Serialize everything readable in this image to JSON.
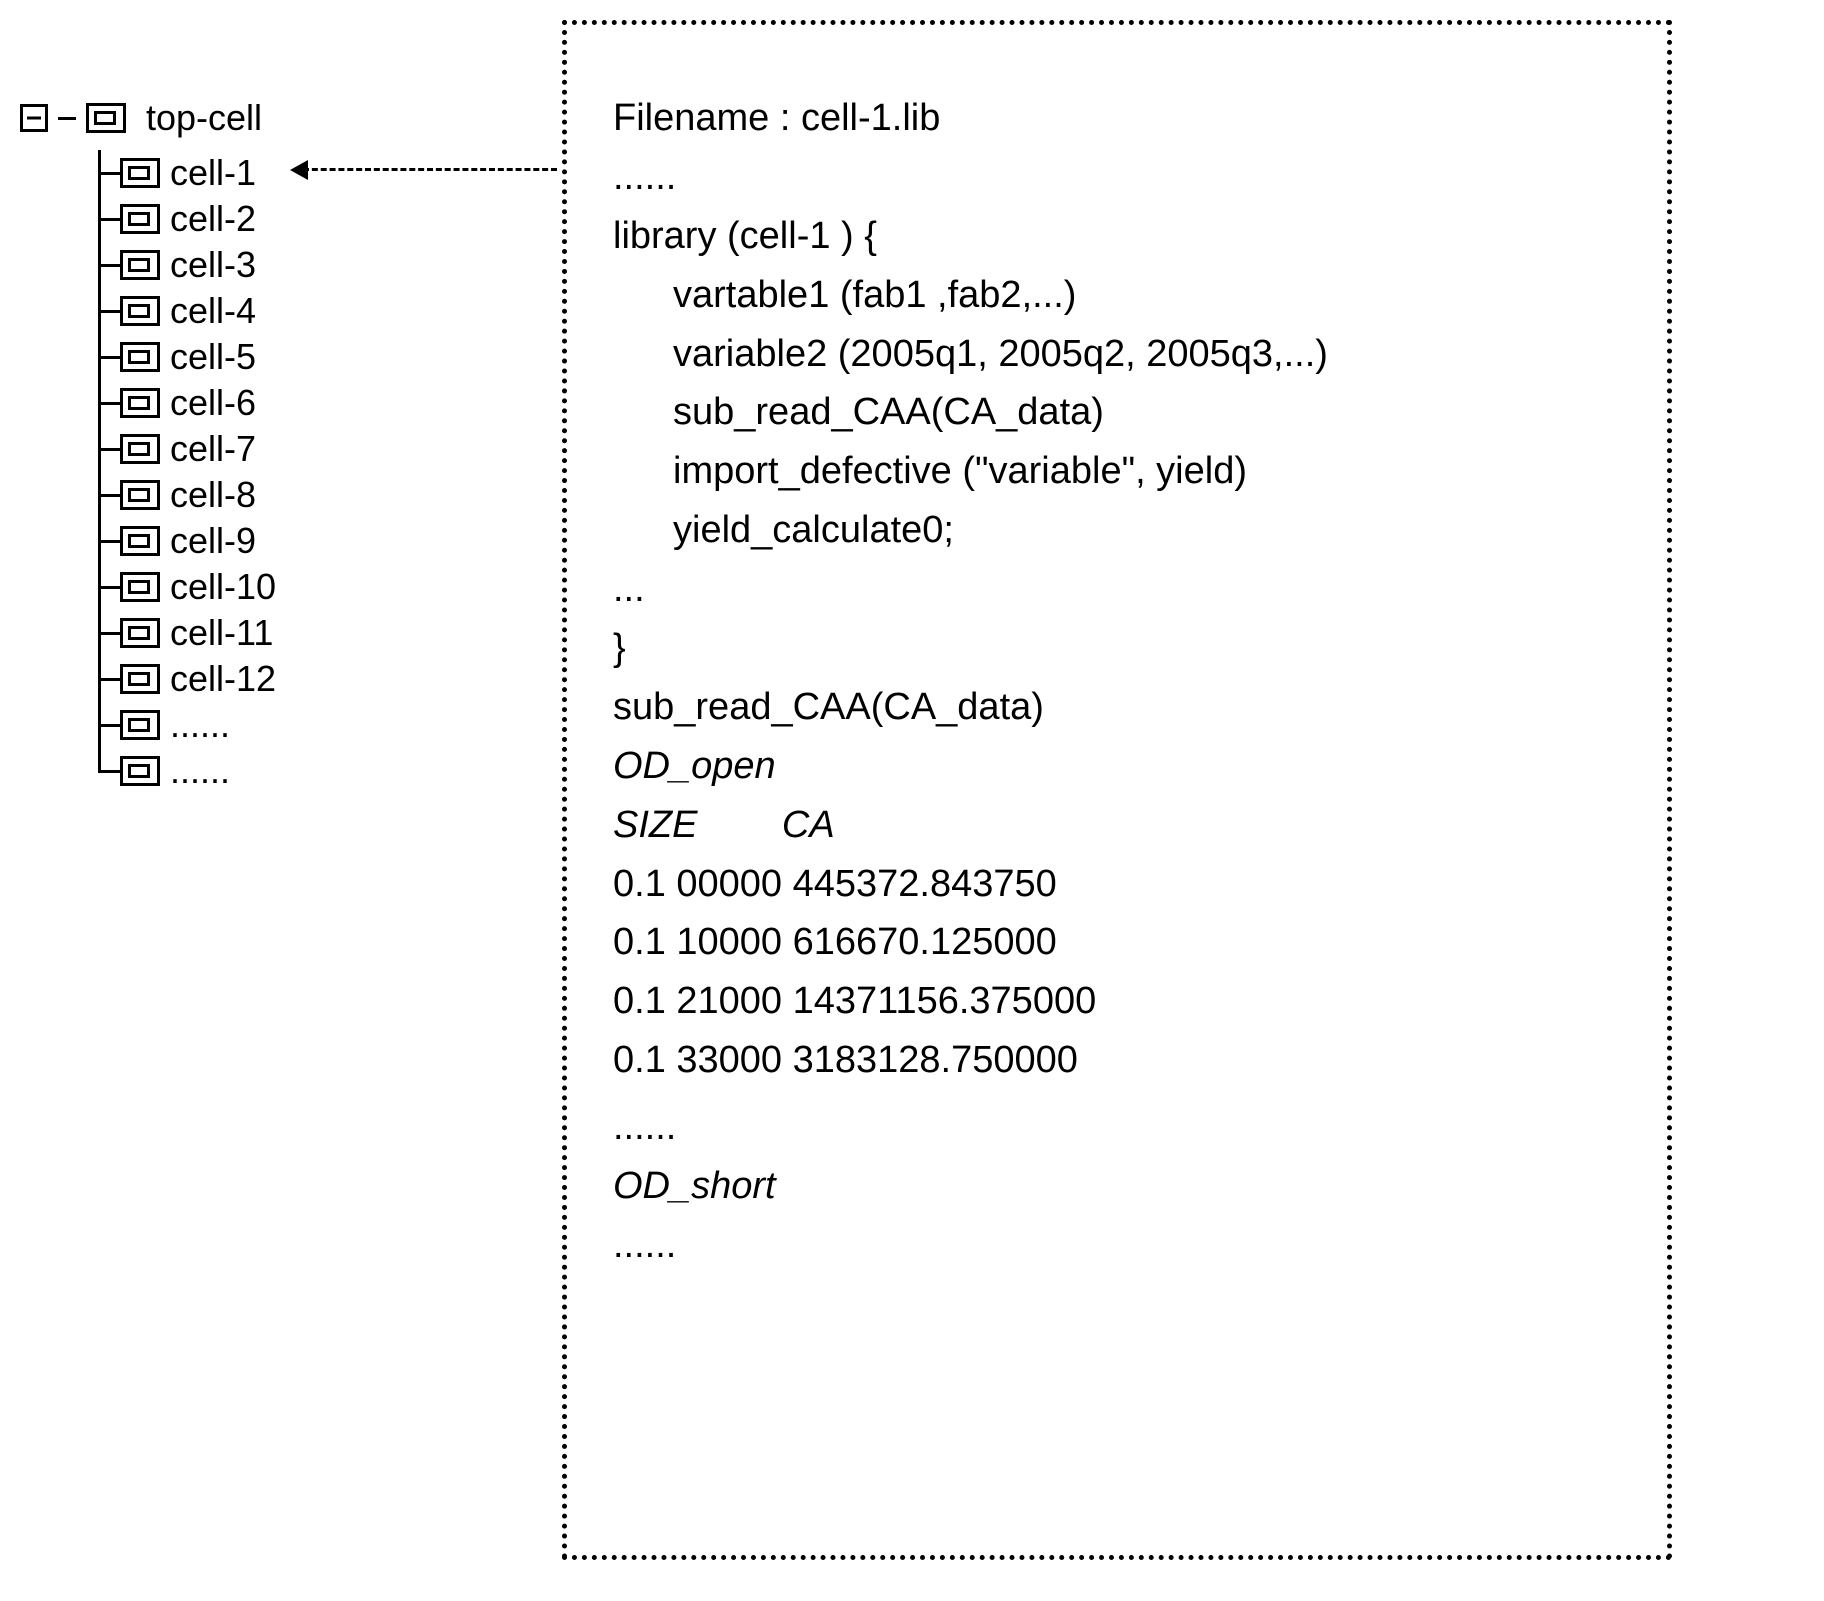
{
  "tree": {
    "root_label": "top-cell",
    "children": [
      {
        "label": "cell-1"
      },
      {
        "label": "cell-2"
      },
      {
        "label": "cell-3"
      },
      {
        "label": "cell-4"
      },
      {
        "label": "cell-5"
      },
      {
        "label": "cell-6"
      },
      {
        "label": "cell-7"
      },
      {
        "label": "cell-8"
      },
      {
        "label": "cell-9"
      },
      {
        "label": "cell-10"
      },
      {
        "label": "cell-11"
      },
      {
        "label": "cell-12"
      },
      {
        "label": "......"
      },
      {
        "label": "......"
      }
    ]
  },
  "file": {
    "header": "Filename : cell-1.lib",
    "ellipsis1": "......",
    "lib_open": "library (cell-1 ) {",
    "body": [
      "vartable1 (fab1 ,fab2,...)",
      "variable2 (2005q1, 2005q2, 2005q3,...)",
      "sub_read_CAA(CA_data)",
      "import_defective (\"variable\", yield)",
      "yield_calculate0;"
    ],
    "ellipsis_mid": "...",
    "lib_close": "}",
    "sub_call": "sub_read_CAA(CA_data)",
    "od_open": "OD_open",
    "table_header": "SIZE        CA",
    "table_rows": [
      "0.1 00000 445372.843750",
      "0.1 10000 616670.125000",
      "0.1 21000 14371156.375000",
      "0.1 33000 3183128.750000"
    ],
    "ellipsis2": "......",
    "od_short": "OD_short",
    "ellipsis3": "......"
  }
}
